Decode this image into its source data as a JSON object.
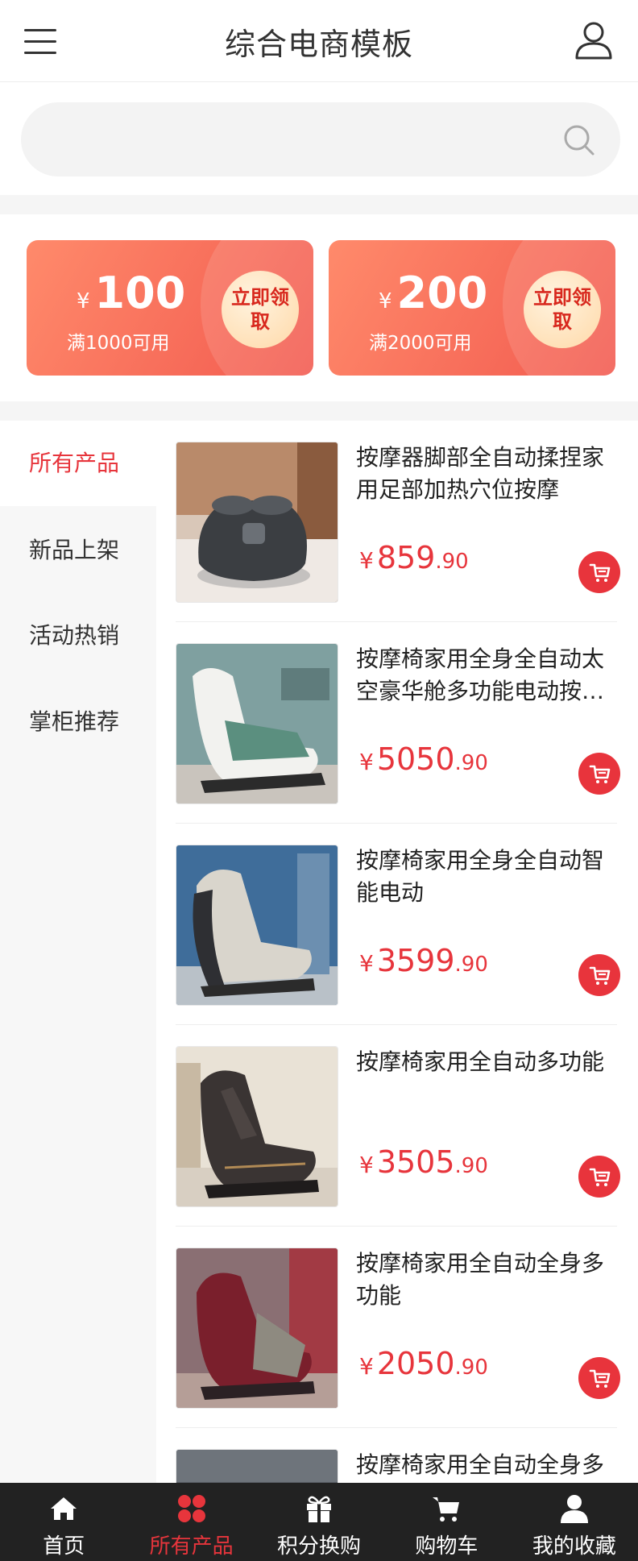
{
  "header": {
    "title": "综合电商模板"
  },
  "search": {
    "placeholder": ""
  },
  "coupons": [
    {
      "symbol": "¥",
      "amount": "100",
      "condition": "满1000可用",
      "action": "立即领取"
    },
    {
      "symbol": "¥",
      "amount": "200",
      "condition": "满2000可用",
      "action": "立即领取"
    }
  ],
  "categories": [
    {
      "label": "所有产品",
      "active": true
    },
    {
      "label": "新品上架",
      "active": false
    },
    {
      "label": "活动热销",
      "active": false
    },
    {
      "label": "掌柜推荐",
      "active": false
    }
  ],
  "products": [
    {
      "name": "按摩器脚部全自动揉捏家用足部加热穴位按摩",
      "currency": "¥",
      "price_int": "859",
      "price_dec": ".90"
    },
    {
      "name": "按摩椅家用全身全自动太空豪华舱多功能电动按…",
      "currency": "¥",
      "price_int": "5050",
      "price_dec": ".90"
    },
    {
      "name": "按摩椅家用全身全自动智能电动",
      "currency": "¥",
      "price_int": "3599",
      "price_dec": ".90"
    },
    {
      "name": "按摩椅家用全自动多功能",
      "currency": "¥",
      "price_int": "3505",
      "price_dec": ".90"
    },
    {
      "name": "按摩椅家用全自动全身多功能",
      "currency": "¥",
      "price_int": "2050",
      "price_dec": ".90"
    },
    {
      "name": "按摩椅家用全自动全身多",
      "currency": "¥",
      "price_int": "",
      "price_dec": ""
    }
  ],
  "bottom_nav": [
    {
      "label": "首页",
      "icon": "home-icon",
      "active": false
    },
    {
      "label": "所有产品",
      "icon": "grid-icon",
      "active": true
    },
    {
      "label": "积分换购",
      "icon": "gift-icon",
      "active": false
    },
    {
      "label": "购物车",
      "icon": "cart-icon",
      "active": false
    },
    {
      "label": "我的收藏",
      "icon": "user-icon",
      "active": false
    }
  ],
  "colors": {
    "accent": "#e7353c",
    "coupon_start": "#ff8a6b",
    "coupon_end": "#f25a4f",
    "nav_bg": "#222222"
  }
}
